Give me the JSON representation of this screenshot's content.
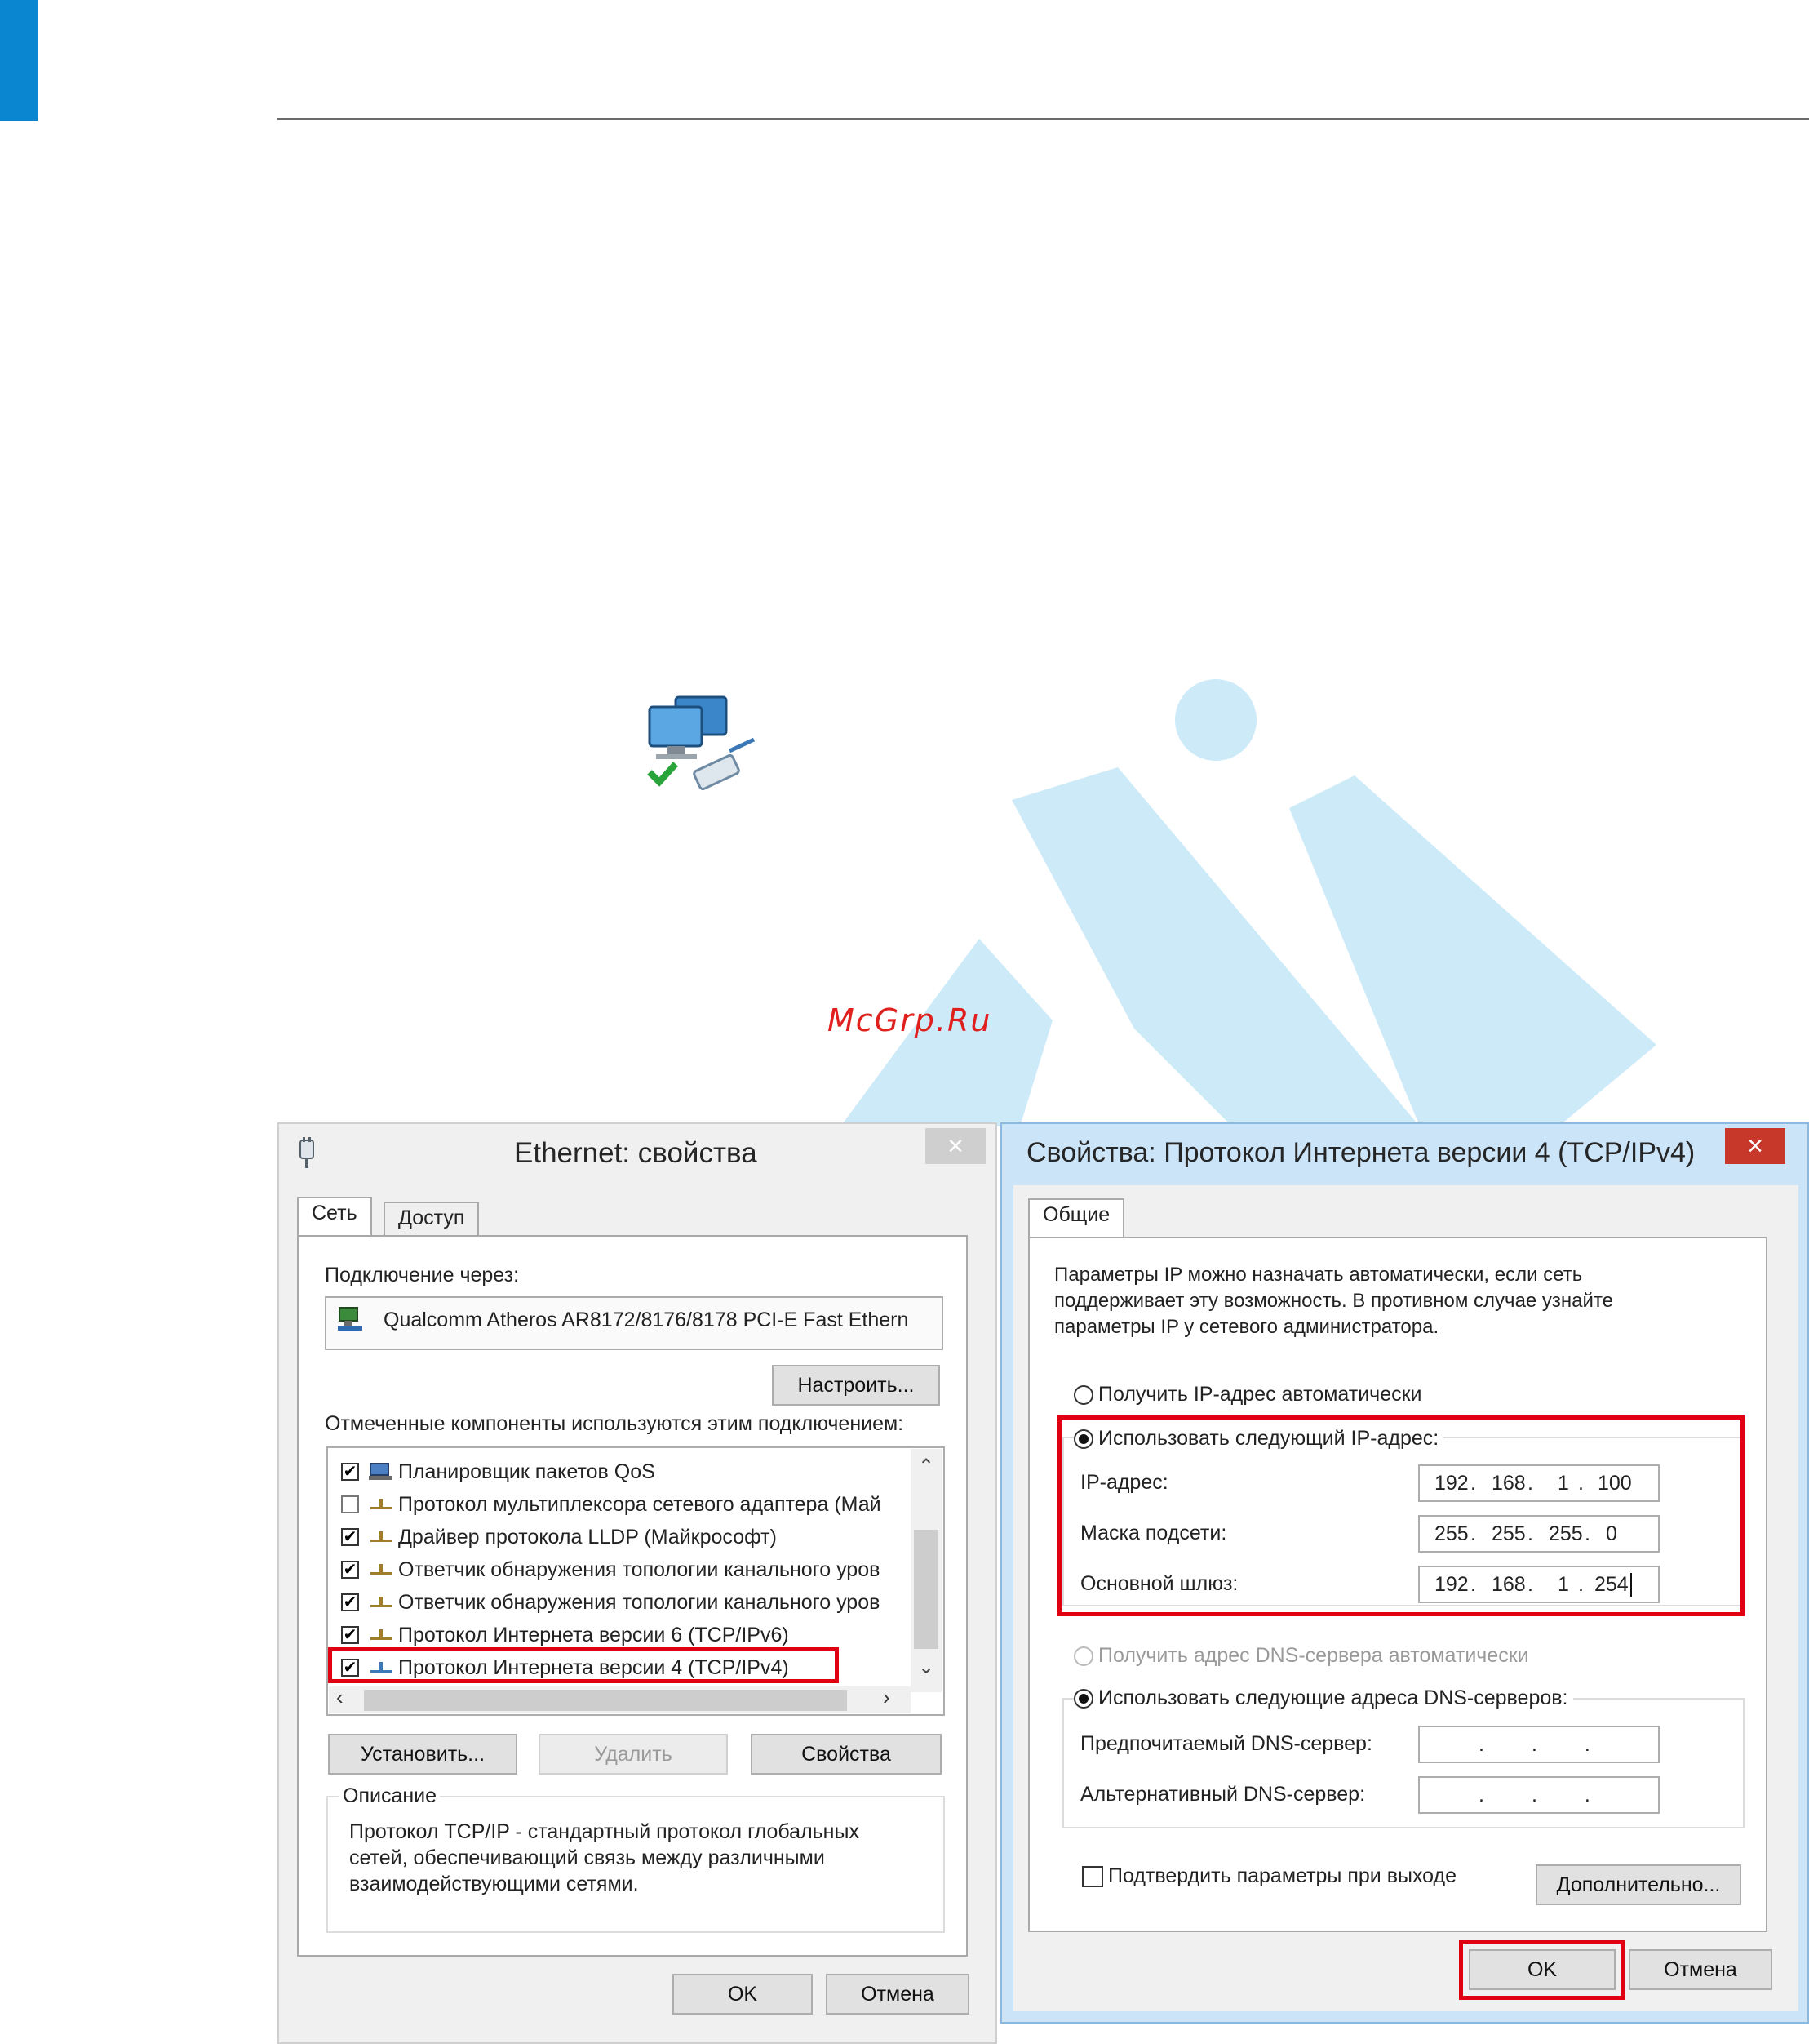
{
  "watermark": "McGrp.Ru",
  "ethernet": {
    "title": "Ethernet: свойства",
    "close": "×",
    "tabs": [
      "Сеть",
      "Доступ"
    ],
    "connect_label": "Подключение через:",
    "adapter": "Qualcomm Atheros AR8172/8176/8178 PCI-E Fast Ethern",
    "configure_btn": "Настроить...",
    "components_label": "Отмеченные компоненты используются этим подключением:",
    "components": [
      {
        "label": "Планировщик пакетов QoS",
        "checked": true
      },
      {
        "label": "Протокол мультиплексора сетевого адаптера (Май",
        "checked": false
      },
      {
        "label": "Драйвер протокола LLDP (Майкрософт)",
        "checked": true
      },
      {
        "label": "Ответчик обнаружения топологии канального уров",
        "checked": true
      },
      {
        "label": "Ответчик обнаружения топологии канального уров",
        "checked": true
      },
      {
        "label": "Протокол Интернета версии 6 (TCP/IPv6)",
        "checked": true
      },
      {
        "label": "Протокол Интернета версии 4 (TCP/IPv4)",
        "checked": true
      }
    ],
    "install_btn": "Установить...",
    "remove_btn": "Удалить",
    "properties_btn": "Свойства",
    "description_label": "Описание",
    "description_lines": [
      "Протокол TCP/IP - стандартный протокол глобальных",
      "сетей, обеспечивающий связь между различными",
      "взаимодействующими сетями."
    ],
    "ok_btn": "OK",
    "cancel_btn": "Отмена"
  },
  "ipv4": {
    "title": "Свойства: Протокол Интернета версии 4 (TCP/IPv4)",
    "close": "×",
    "tab": "Общие",
    "intro_lines": [
      "Параметры IP можно назначать автоматически, если сеть",
      "поддерживает эту возможность. В противном случае узнайте",
      "параметры IP у сетевого администратора."
    ],
    "auto_ip": "Получить IP-адрес автоматически",
    "manual_ip": "Использовать следующий IP-адрес:",
    "ip_label": "IP-адрес:",
    "ip_value": [
      "192",
      "168",
      "1",
      "100"
    ],
    "mask_label": "Маска подсети:",
    "mask_value": [
      "255",
      "255",
      "255",
      "0"
    ],
    "gateway_label": "Основной шлюз:",
    "gateway_value": [
      "192",
      "168",
      "1",
      "254"
    ],
    "auto_dns": "Получить адрес DNS-сервера автоматически",
    "manual_dns": "Использовать следующие адреса DNS-серверов:",
    "pref_dns_label": "Предпочитаемый DNS-сервер:",
    "alt_dns_label": "Альтернативный DNS-сервер:",
    "confirm_label": "Подтвердить параметры при выходе",
    "advanced_btn": "Дополнительно...",
    "ok_btn": "OK",
    "cancel_btn": "Отмена"
  }
}
